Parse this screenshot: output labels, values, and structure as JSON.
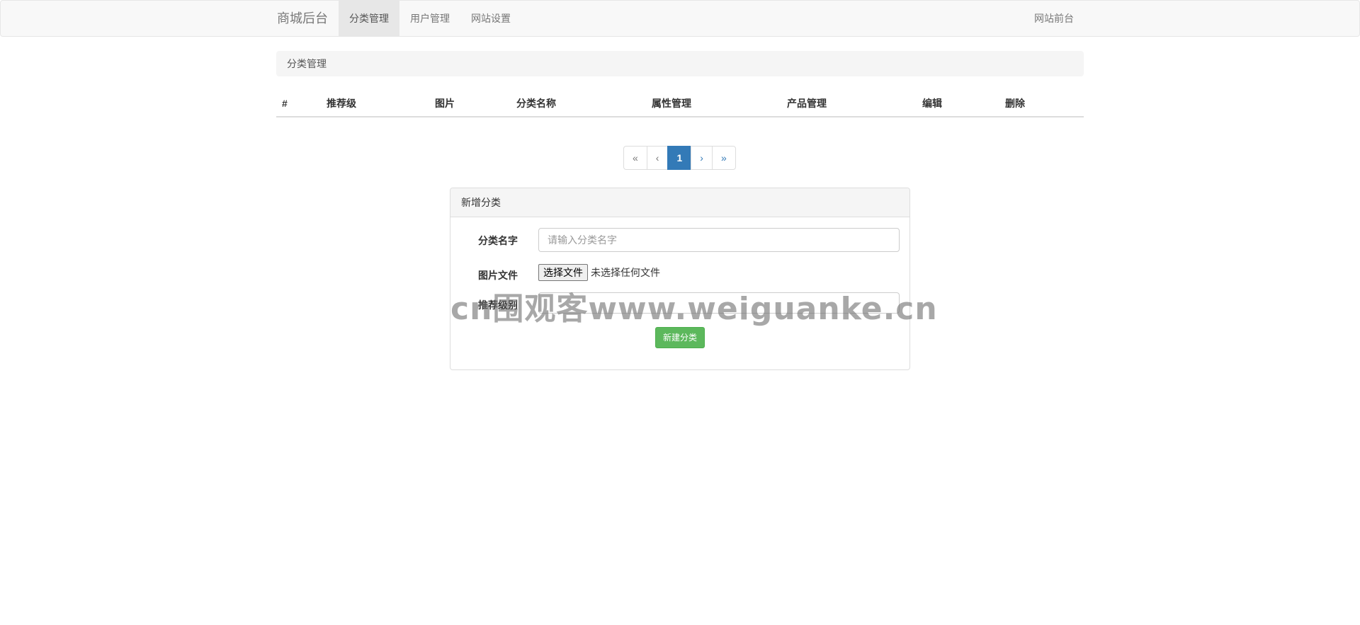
{
  "navbar": {
    "brand": "商城后台",
    "items": [
      {
        "label": "分类管理",
        "active": true
      },
      {
        "label": "用户管理",
        "active": false
      },
      {
        "label": "网站设置",
        "active": false
      }
    ],
    "right_link": "网站前台"
  },
  "breadcrumb": "分类管理",
  "table": {
    "headers": [
      "#",
      "推荐级",
      "图片",
      "分类名称",
      "属性管理",
      "产品管理",
      "编辑",
      "删除"
    ]
  },
  "pagination": {
    "first": "«",
    "prev": "‹",
    "current": "1",
    "next": "›",
    "last": "»"
  },
  "form": {
    "title": "新增分类",
    "name_label": "分类名字",
    "name_placeholder": "请输入分类名字",
    "image_label": "图片文件",
    "file_button": "选择文件",
    "file_status": "未选择任何文件",
    "recommend_label": "推荐级别",
    "submit_label": "新建分类"
  },
  "watermark": "cn围观客www.weiguanke.cn",
  "colors": {
    "primary": "#337ab7",
    "success": "#5cb85c",
    "navbar_bg": "#f8f8f8"
  }
}
